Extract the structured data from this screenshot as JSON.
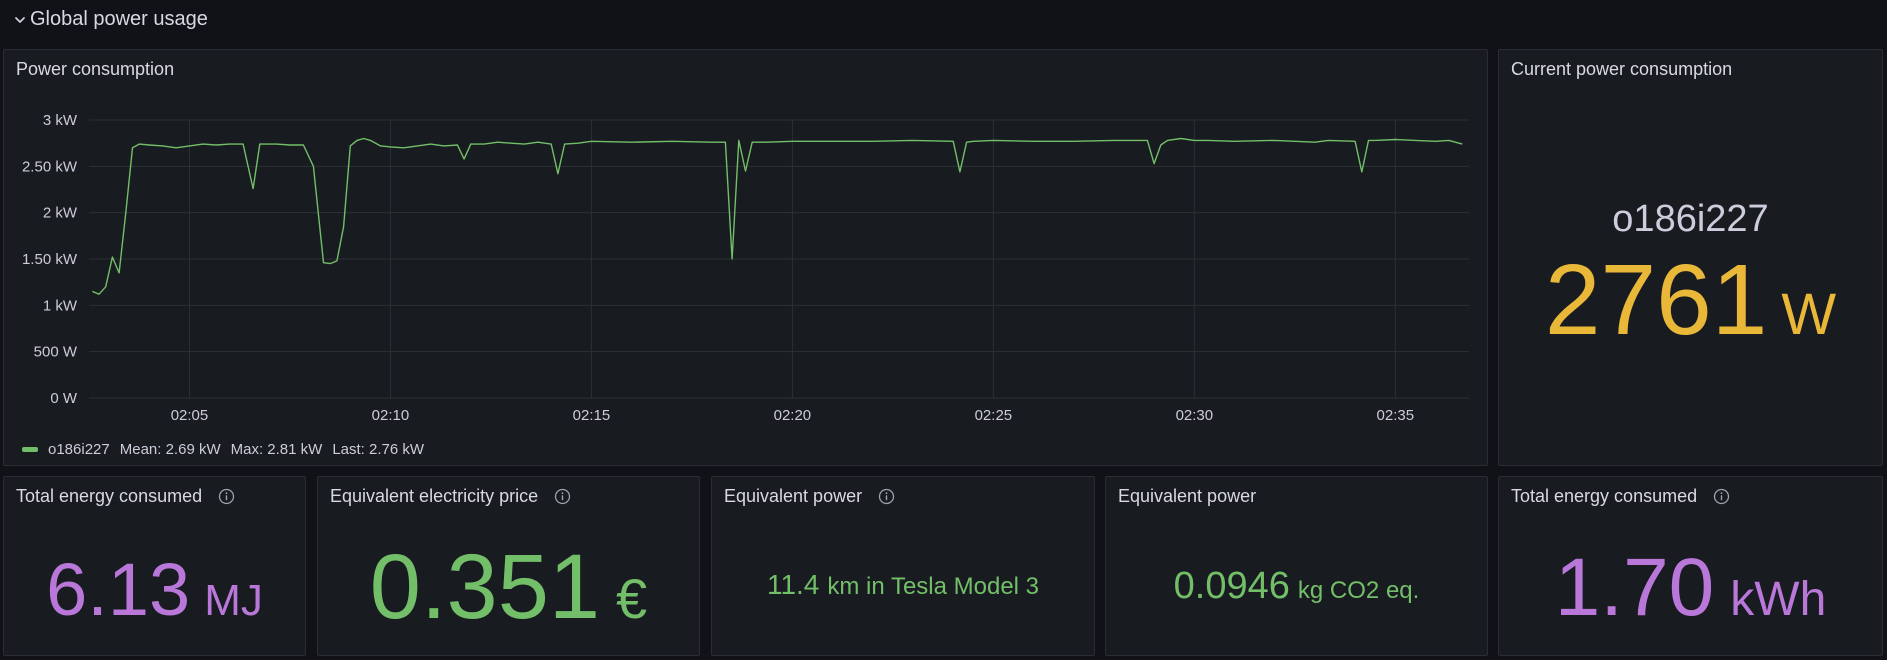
{
  "row": {
    "title": "Global power usage",
    "chevron_icon": "chevron-down-icon"
  },
  "panels": {
    "timeseries": {
      "title": "Power consumption",
      "legend": {
        "series_name": "o186i227",
        "mean": "Mean: 2.69 kW",
        "max": "Max: 2.81 kW",
        "last": "Last: 2.76 kW"
      }
    },
    "current": {
      "title": "Current power consumption",
      "label": "o186i227",
      "value": "2761",
      "unit": "W"
    },
    "energy_mj": {
      "title": "Total energy consumed",
      "value": "6.13",
      "unit": "MJ"
    },
    "price": {
      "title": "Equivalent electricity price",
      "value": "0.351",
      "unit": "€"
    },
    "tesla": {
      "title": "Equivalent power",
      "value": "11.4",
      "unit": "km in Tesla Model 3"
    },
    "co2": {
      "title": "Equivalent power",
      "value": "0.0946",
      "unit": "kg CO2 eq."
    },
    "energy_kwh": {
      "title": "Total energy consumed",
      "value": "1.70",
      "unit": "kWh"
    }
  },
  "colors": {
    "background": "#111217",
    "panel": "#181b1f",
    "series": "#73bf69",
    "yellow": "#eab839",
    "purple": "#b877d9",
    "green": "#73bf69",
    "grid": "#2c3035"
  },
  "chart_data": {
    "type": "line",
    "title": "Power consumption",
    "xlabel": "",
    "ylabel": "",
    "x_range": [
      "02:02:30",
      "02:36:50"
    ],
    "ylim": [
      0,
      3000
    ],
    "y_unit": "W",
    "y_ticks": [
      {
        "value": 3000,
        "label": "3 kW"
      },
      {
        "value": 2500,
        "label": "2.50 kW"
      },
      {
        "value": 2000,
        "label": "2 kW"
      },
      {
        "value": 1500,
        "label": "1.50 kW"
      },
      {
        "value": 1000,
        "label": "1 kW"
      },
      {
        "value": 500,
        "label": "500 W"
      },
      {
        "value": 0,
        "label": "0 W"
      }
    ],
    "x_ticks": [
      {
        "value": "02:05",
        "label": "02:05"
      },
      {
        "value": "02:10",
        "label": "02:10"
      },
      {
        "value": "02:15",
        "label": "02:15"
      },
      {
        "value": "02:20",
        "label": "02:20"
      },
      {
        "value": "02:25",
        "label": "02:25"
      },
      {
        "value": "02:30",
        "label": "02:30"
      },
      {
        "value": "02:35",
        "label": "02:35"
      }
    ],
    "grid": true,
    "legend": "bottom-left",
    "series": [
      {
        "name": "o186i227",
        "x": [
          "02:02:35",
          "02:02:45",
          "02:02:55",
          "02:03:05",
          "02:03:15",
          "02:03:25",
          "02:03:35",
          "02:03:45",
          "02:04:00",
          "02:04:20",
          "02:04:40",
          "02:05:00",
          "02:05:20",
          "02:05:40",
          "02:06:00",
          "02:06:20",
          "02:06:35",
          "02:06:45",
          "02:06:55",
          "02:07:10",
          "02:07:30",
          "02:07:50",
          "02:08:05",
          "02:08:20",
          "02:08:30",
          "02:08:40",
          "02:08:50",
          "02:09:00",
          "02:09:10",
          "02:09:20",
          "02:09:30",
          "02:09:45",
          "02:10:00",
          "02:10:20",
          "02:10:40",
          "02:11:00",
          "02:11:20",
          "02:11:40",
          "02:11:50",
          "02:12:00",
          "02:12:20",
          "02:12:40",
          "02:13:00",
          "02:13:20",
          "02:13:40",
          "02:14:00",
          "02:14:10",
          "02:14:20",
          "02:14:40",
          "02:15:00",
          "02:16:00",
          "02:17:00",
          "02:18:00",
          "02:18:20",
          "02:18:30",
          "02:18:40",
          "02:18:50",
          "02:19:00",
          "02:19:20",
          "02:20:00",
          "02:21:00",
          "02:22:00",
          "02:23:00",
          "02:24:00",
          "02:24:10",
          "02:24:20",
          "02:24:30",
          "02:25:00",
          "02:26:00",
          "02:27:00",
          "02:28:00",
          "02:28:50",
          "02:29:00",
          "02:29:10",
          "02:29:20",
          "02:29:40",
          "02:30:00",
          "02:30:20",
          "02:31:00",
          "02:32:00",
          "02:33:00",
          "02:33:20",
          "02:34:00",
          "02:34:10",
          "02:34:20",
          "02:34:30",
          "02:35:00",
          "02:35:30",
          "02:36:00",
          "02:36:20",
          "02:36:40"
        ],
        "y": [
          1150,
          1120,
          1200,
          1520,
          1350,
          2000,
          2700,
          2740,
          2730,
          2720,
          2700,
          2720,
          2740,
          2730,
          2740,
          2740,
          2260,
          2740,
          2740,
          2740,
          2730,
          2730,
          2500,
          1460,
          1450,
          1480,
          1850,
          2720,
          2780,
          2800,
          2780,
          2720,
          2710,
          2700,
          2720,
          2740,
          2720,
          2730,
          2580,
          2740,
          2740,
          2760,
          2750,
          2740,
          2760,
          2740,
          2420,
          2740,
          2750,
          2770,
          2760,
          2770,
          2760,
          2760,
          1500,
          2780,
          2450,
          2760,
          2760,
          2770,
          2770,
          2770,
          2780,
          2770,
          2440,
          2760,
          2770,
          2780,
          2770,
          2770,
          2780,
          2780,
          2530,
          2730,
          2780,
          2800,
          2780,
          2780,
          2770,
          2780,
          2760,
          2780,
          2770,
          2440,
          2780,
          2780,
          2790,
          2780,
          2770,
          2780,
          2740
        ]
      }
    ]
  }
}
